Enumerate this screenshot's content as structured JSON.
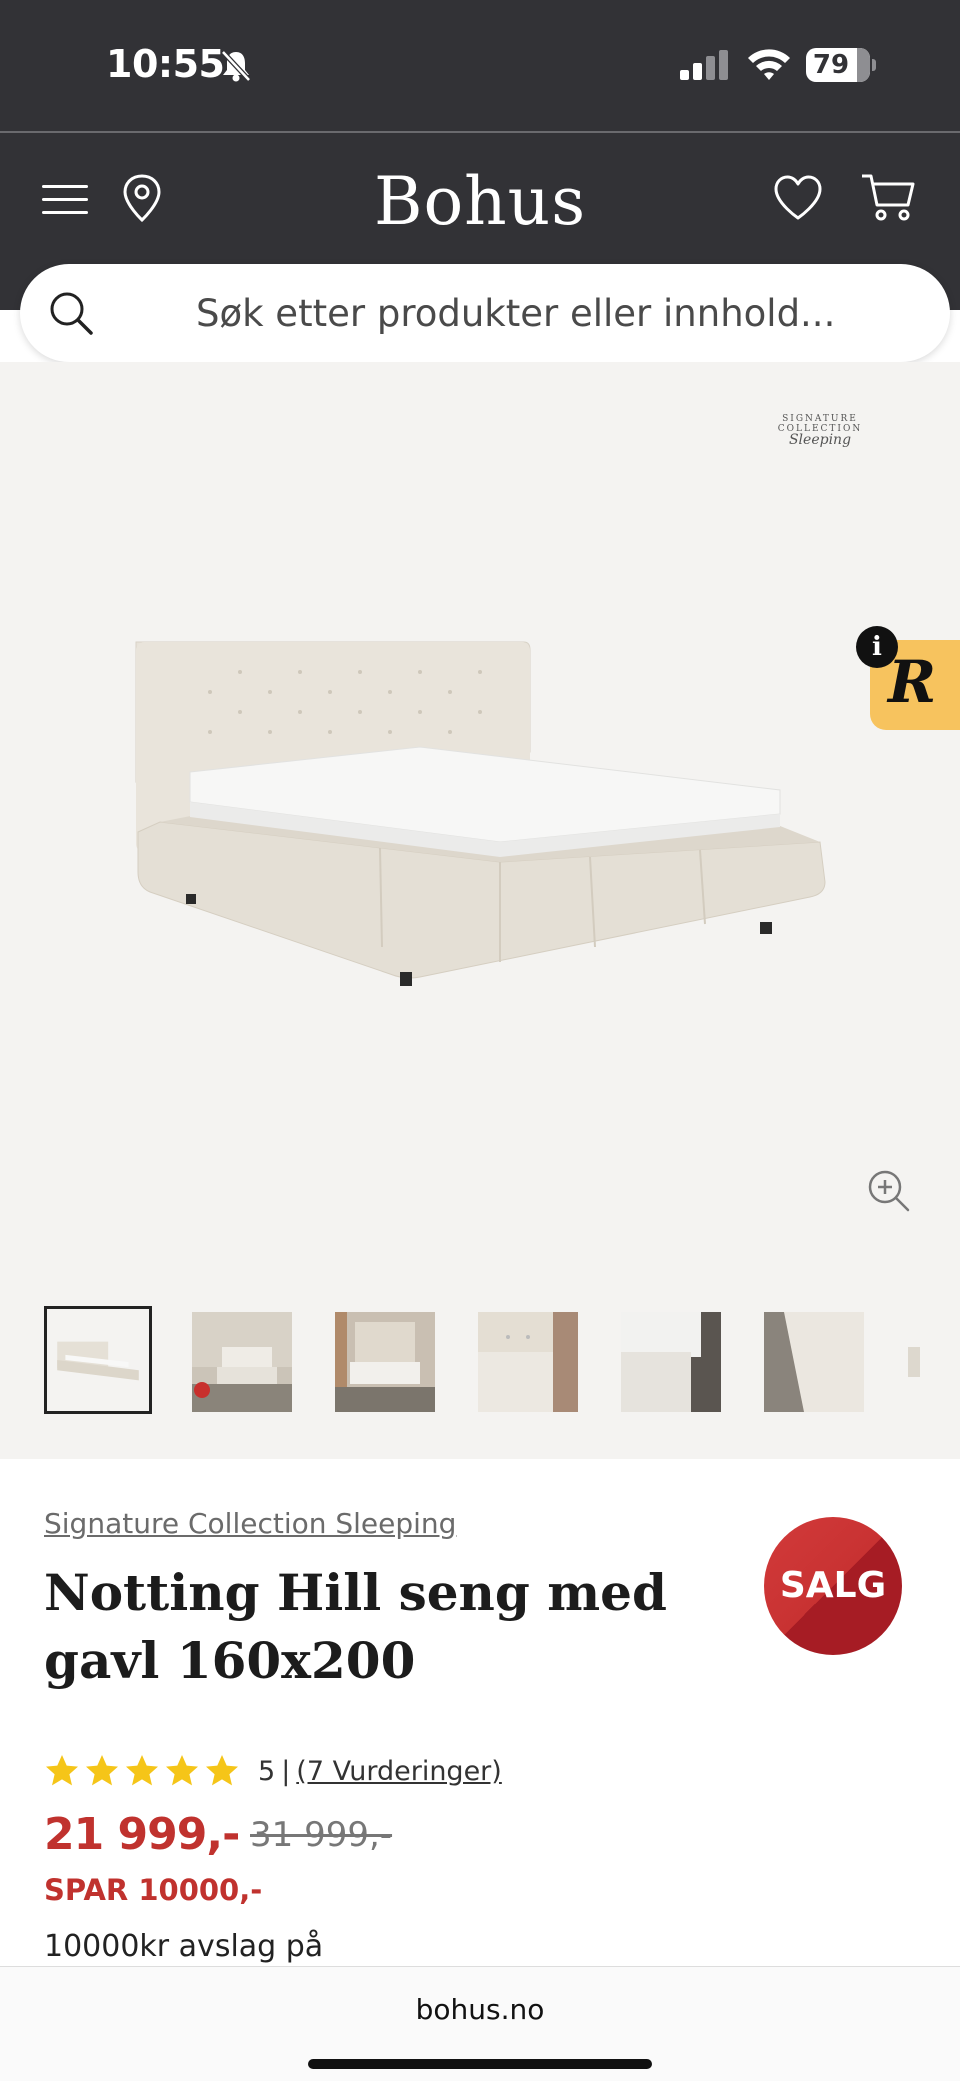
{
  "status_bar": {
    "time": "10:55",
    "battery": "79",
    "battery_level": 0.79
  },
  "header": {
    "brand": "Bohus"
  },
  "search": {
    "placeholder": "Søk etter produkter eller innhold..."
  },
  "gallery": {
    "collection_logo_top": "SIGNATURE COLLECTION",
    "collection_logo_script": "Sleeping",
    "review_widget_letter": "R",
    "info_badge": "i",
    "thumbnails_count": 7,
    "active_thumbnail": 1
  },
  "product": {
    "brand_link": "Signature Collection Sleeping",
    "title": "Notting Hill seng med gavl 160x200",
    "sale_badge": "SALG",
    "rating_value": "5",
    "rating_separator": "|",
    "rating_link": "(7 Vurderinger)",
    "rating_stars": 5,
    "price": "21 999,-",
    "old_price": "31 999,-",
    "savings": "SPAR 10000,-",
    "promo_text": "10000kr avslag på"
  },
  "browser": {
    "url": "bohus.no"
  },
  "colors": {
    "header_bg": "#323236",
    "price_red": "#c0322e",
    "star_yellow": "#f5c518",
    "gallery_bg": "#f4f3f1"
  }
}
